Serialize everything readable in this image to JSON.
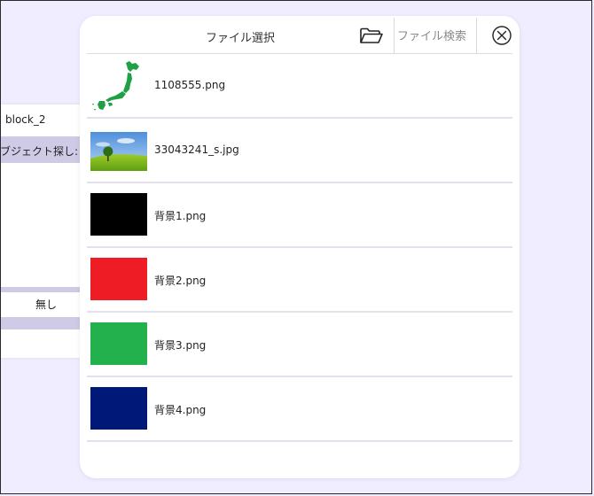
{
  "background_panel": {
    "title": "block_2",
    "selected_item": "ブジェクト探し:",
    "none_label": "無し"
  },
  "dialog": {
    "title": "ファイル選択",
    "folder_icon": "folder-open-icon",
    "search_placeholder": "ファイル検索",
    "close_icon": "close-circle-icon"
  },
  "files": [
    {
      "name": "1108555.png",
      "thumb": "japan-map-icon",
      "color": "#20a044"
    },
    {
      "name": "33043241_s.jpg",
      "thumb": "landscape-photo"
    },
    {
      "name": "背景1.png",
      "thumb": "solid",
      "color": "#000000"
    },
    {
      "name": "背景2.png",
      "thumb": "solid",
      "color": "#ee1c25"
    },
    {
      "name": "背景3.png",
      "thumb": "solid",
      "color": "#22b14c"
    },
    {
      "name": "背景4.png",
      "thumb": "solid",
      "color": "#001878"
    }
  ],
  "colors": {
    "page_bg": "#efedff",
    "band": "#cfcae6",
    "divider": "#e3e1ee"
  }
}
